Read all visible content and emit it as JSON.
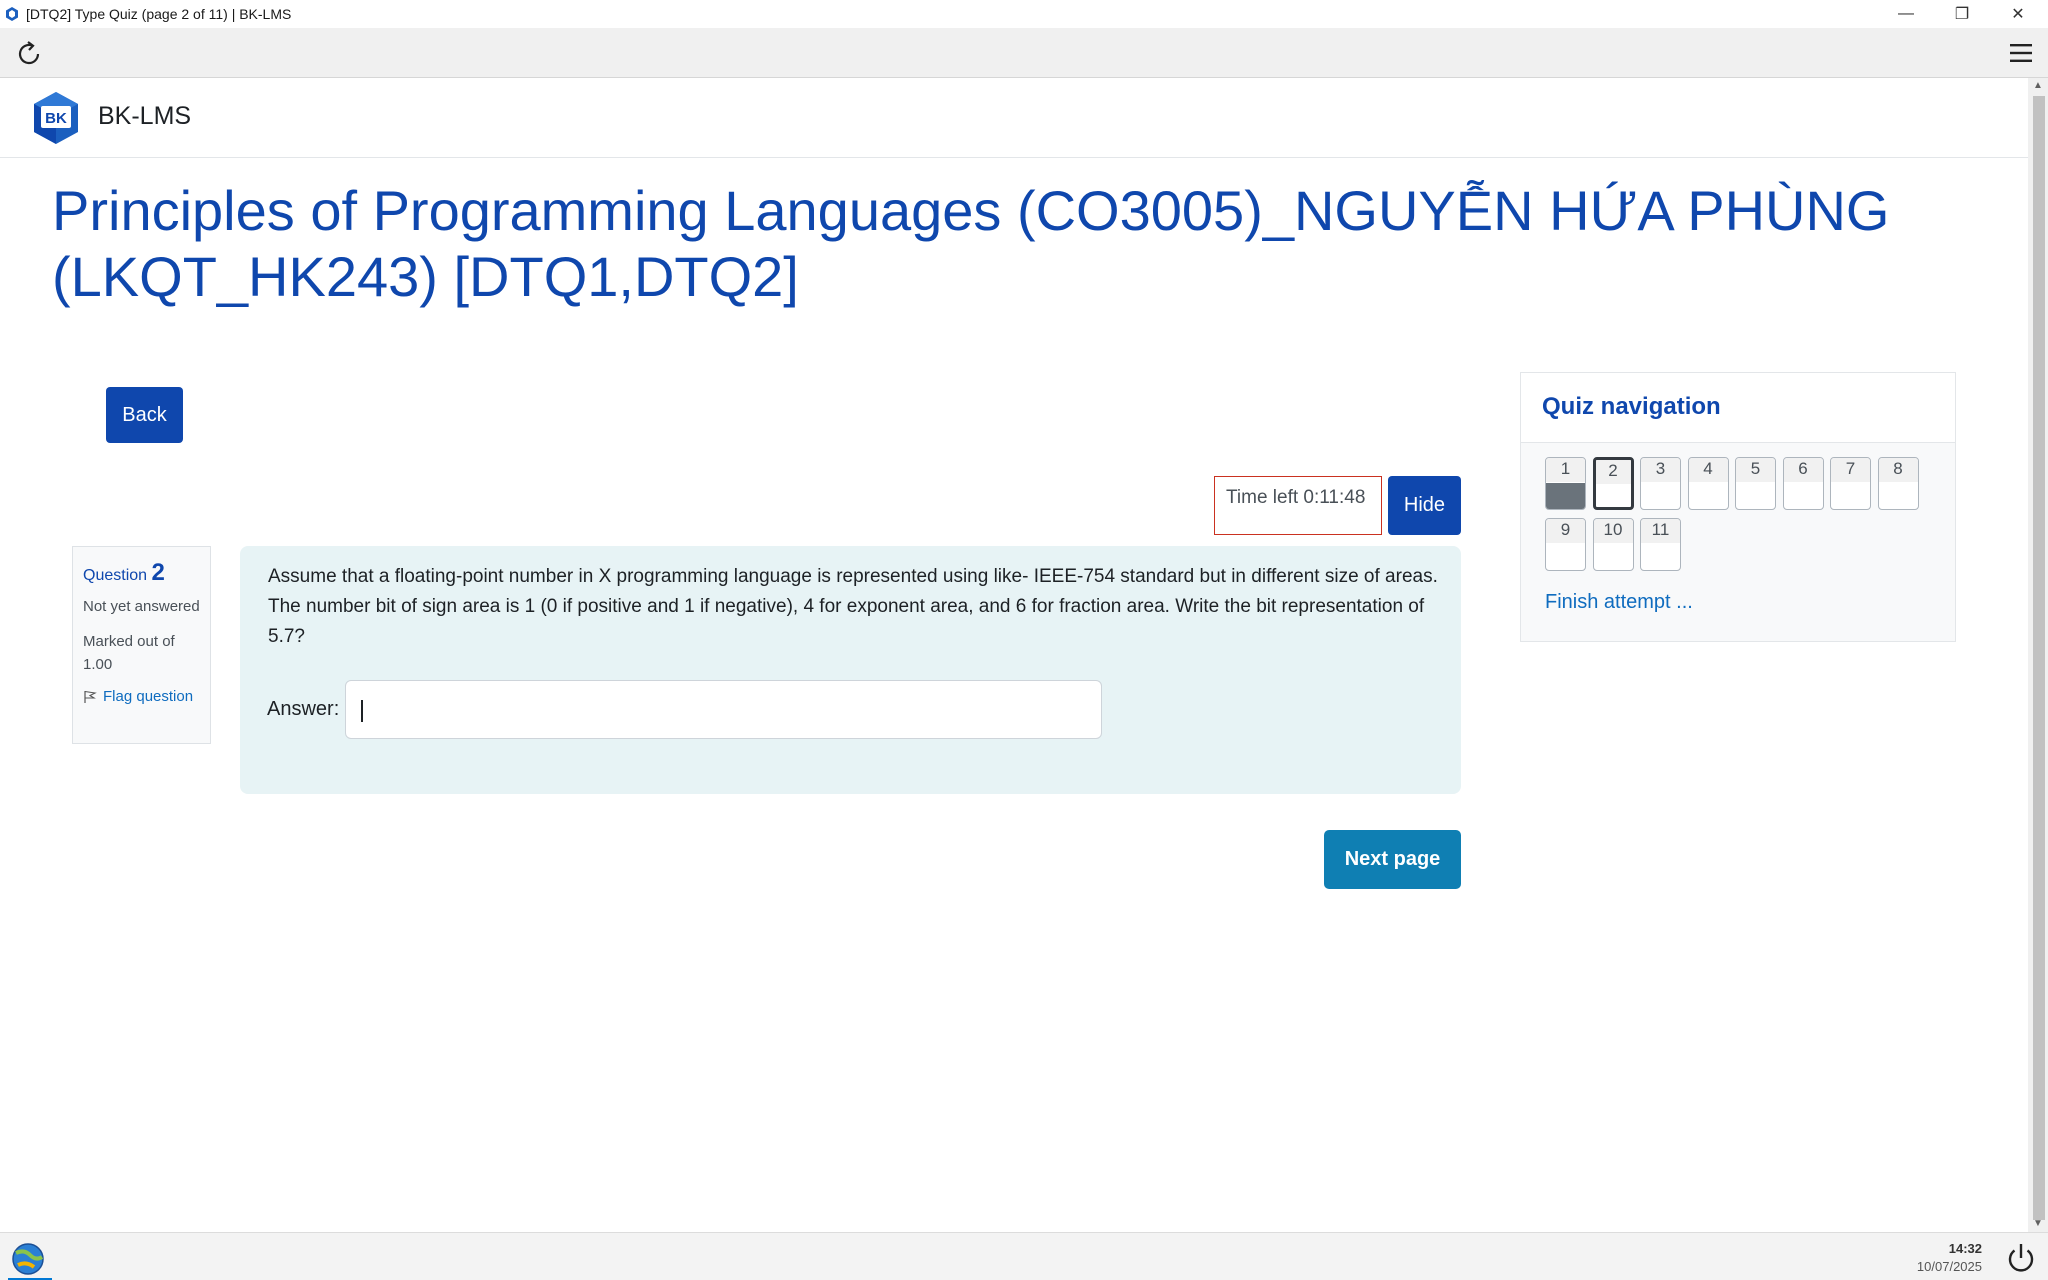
{
  "window": {
    "title": "[DTQ2] Type Quiz (page 2 of 11) | BK-LMS",
    "minimize_glyph": "—",
    "restore_glyph": "❐",
    "close_glyph": "✕"
  },
  "toolbar": {
    "reload_icon": "reload-icon",
    "menu_icon": "hamburger-menu-icon"
  },
  "site": {
    "logo_text": "BK",
    "name": "BK-LMS"
  },
  "course": {
    "title": "Principles of Programming Languages (CO3005)_NGUYỄN HỨA PHÙNG (LKQT_HK243) [DTQ1,DTQ2]"
  },
  "buttons": {
    "back": "Back",
    "hide": "Hide",
    "next": "Next page"
  },
  "timer": {
    "text": "Time left 0:11:48"
  },
  "question": {
    "label": "Question",
    "number": "2",
    "state": "Not yet answered",
    "grade": "Marked out of 1.00",
    "flag": "Flag question",
    "text": "Assume that a floating-point number in X programming language is represented using like- IEEE-754 standard but in different size of areas. The number bit of sign area is 1 (0 if positive and 1 if negative), 4 for exponent area, and 6 for fraction area. Write the bit representation of 5.7?",
    "answer_label": "Answer:",
    "answer_value": ""
  },
  "quiz_nav": {
    "title": "Quiz navigation",
    "items": [
      {
        "label": "1",
        "status": "answered"
      },
      {
        "label": "2",
        "status": "current"
      },
      {
        "label": "3",
        "status": "unanswered"
      },
      {
        "label": "4",
        "status": "unanswered"
      },
      {
        "label": "5",
        "status": "unanswered"
      },
      {
        "label": "6",
        "status": "unanswered"
      },
      {
        "label": "7",
        "status": "unanswered"
      },
      {
        "label": "8",
        "status": "unanswered"
      },
      {
        "label": "9",
        "status": "unanswered"
      },
      {
        "label": "10",
        "status": "unanswered"
      },
      {
        "label": "11",
        "status": "unanswered"
      }
    ],
    "finish": "Finish attempt ..."
  },
  "taskbar": {
    "time": "14:32",
    "date": "10/07/2025"
  },
  "colors": {
    "brand": "#0f47ad",
    "link": "#0f6cbf",
    "next_button": "#0f7fb3",
    "question_bg": "#e7f3f5",
    "timer_border": "#ca3120"
  }
}
